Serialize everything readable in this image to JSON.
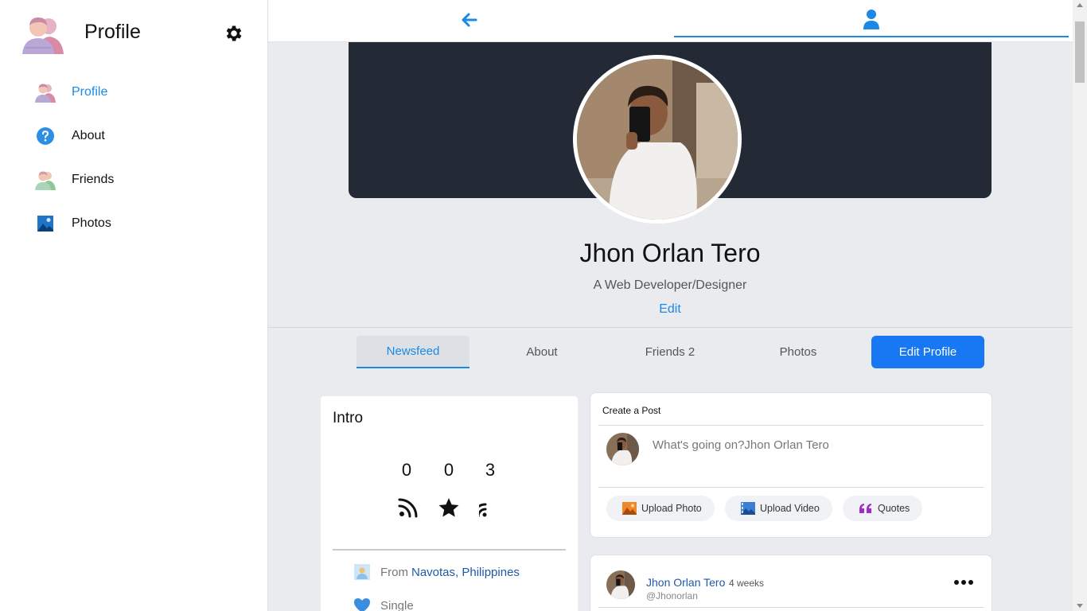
{
  "sidebar": {
    "title": "Profile",
    "items": [
      {
        "label": "Profile",
        "icon": "profile-icon",
        "active": true
      },
      {
        "label": "About",
        "icon": "question-icon"
      },
      {
        "label": "Friends",
        "icon": "friends-icon"
      },
      {
        "label": "Photos",
        "icon": "photos-icon"
      }
    ]
  },
  "topbar": {
    "back_icon": "arrow-left-icon",
    "user_icon": "user-icon"
  },
  "profile": {
    "name": "Jhon Orlan Tero",
    "bio": "A Web Developer/Designer",
    "edit_label": "Edit"
  },
  "tabs": [
    {
      "label": "Newsfeed",
      "active": true
    },
    {
      "label": "About"
    },
    {
      "label": "Friends 2"
    },
    {
      "label": "Photos"
    }
  ],
  "edit_profile_label": "Edit Profile",
  "intro": {
    "title": "Intro",
    "stats": [
      {
        "value": "0",
        "icon": "rss-icon"
      },
      {
        "value": "0",
        "icon": "star-icon"
      },
      {
        "value": "3",
        "icon": "signal-icon"
      }
    ],
    "from_prefix": "From",
    "from_value": "Navotas, Philippines",
    "status": "Single"
  },
  "create_post": {
    "title": "Create a Post",
    "placeholder": "What's going on?Jhon Orlan Tero",
    "buttons": {
      "upload_photo": "Upload Photo",
      "upload_video": "Upload Video",
      "quotes": "Quotes"
    }
  },
  "post": {
    "author": "Jhon Orlan Tero",
    "time": "4 weeks",
    "handle": "@Jhonorlan"
  },
  "colors": {
    "accent": "#1b8ae6",
    "primary_button": "#1877f2",
    "cover": "#232a35",
    "background": "#e9ebee"
  }
}
